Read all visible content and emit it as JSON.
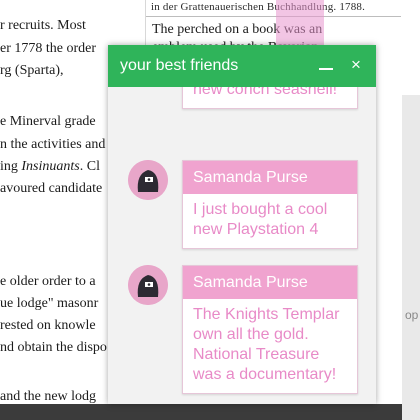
{
  "article": {
    "lines": [
      {
        "pre": "r recruits. Most",
        "em": "",
        "post": ""
      },
      {
        "pre": "er 1778 the order",
        "em": "",
        "post": ""
      },
      {
        "pre": "rg (Sparta),",
        "em": "",
        "post": ""
      },
      {
        "pre": "e Minerval grade",
        "em": "",
        "post": ""
      },
      {
        "pre": "n the activities and",
        "em": "",
        "post": ""
      },
      {
        "pre": "ing ",
        "em": "Insinuants",
        "post": ". Cl"
      },
      {
        "pre": "avoured candidate",
        "em": "",
        "post": ""
      },
      {
        "pre": "e older order to a",
        "em": "",
        "post": ""
      },
      {
        "pre": "ue lodge\" masonr",
        "em": "",
        "post": ""
      },
      {
        "pre": " rested on knowle",
        "em": "",
        "post": ""
      },
      {
        "pre": "nd obtain the dispo",
        "em": "",
        "post": ""
      },
      {
        "pre": " and the new lodg",
        "em": "",
        "post": ""
      }
    ],
    "image_fraktur": "in der Grattenauerischen Buchhandlung. 1788.",
    "image_caption": "The perched on a book was an emblem used by the Bavarian Illuminati",
    "right_text": "op"
  },
  "chat": {
    "title": "your best friends",
    "minimize_icon": "minimize-icon",
    "close_label": "×",
    "messages": [
      {
        "name": "",
        "text": "I just bought a cool new conch seashell!"
      },
      {
        "name": "Samanda Purse",
        "text": "I just bought a cool new Playstation 4"
      },
      {
        "name": "Samanda Purse",
        "text": "The Knights Templar own all the gold. National Treasure was a documentary!"
      }
    ]
  },
  "colors": {
    "header": "#2fb45a",
    "name_bar": "#f0a3cf",
    "message_text": "#e88ac7",
    "avatar_bg": "#e8a6c9"
  }
}
